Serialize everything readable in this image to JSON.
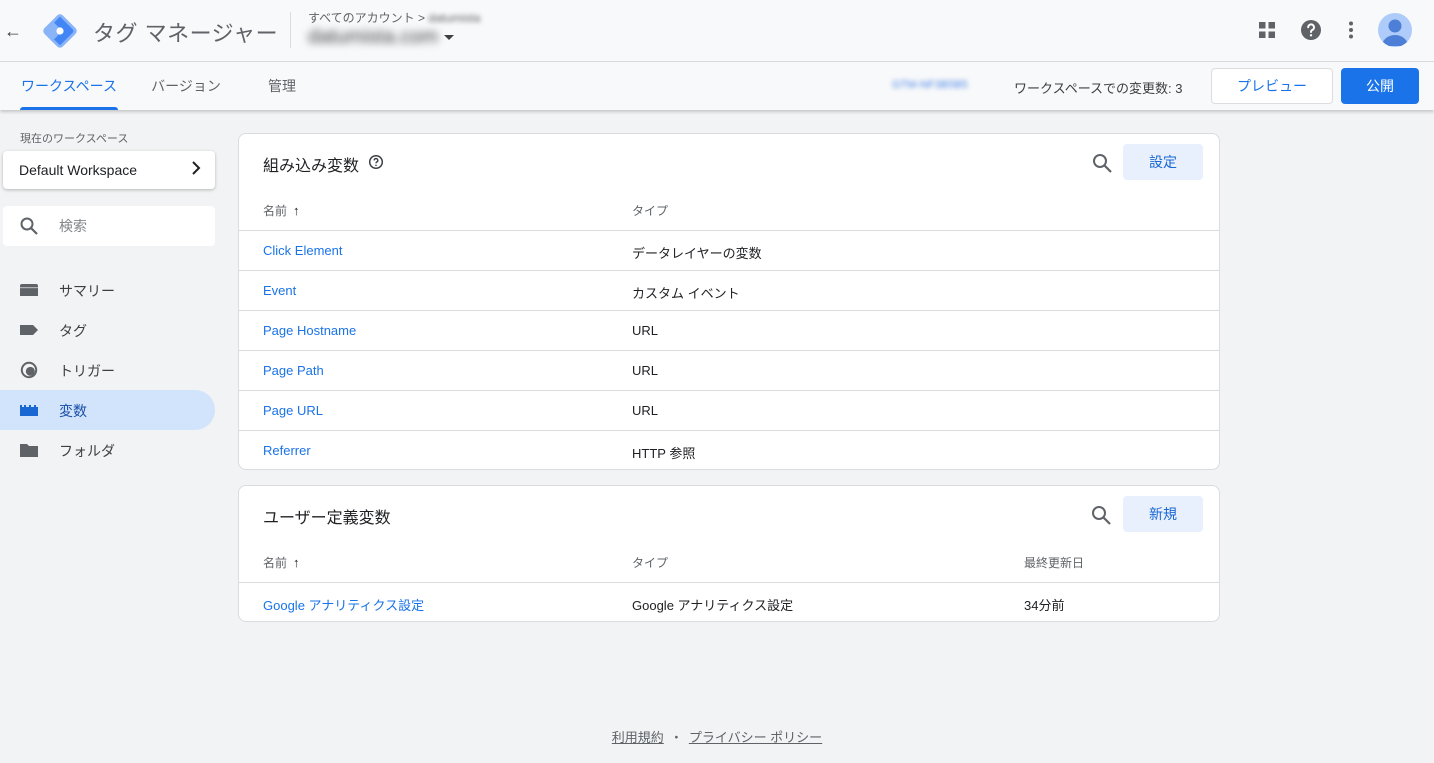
{
  "header": {
    "back_icon": "arrow-back-icon",
    "app_title": "タグ マネージャー",
    "breadcrumb_root": "すべてのアカウント",
    "breadcrumb_sep": ">",
    "breadcrumb_account": "datumista",
    "container_name": "datumista.com",
    "icons": [
      "apps-grid-icon",
      "help-icon",
      "more-vert-icon",
      "account-avatar-icon"
    ]
  },
  "subnav": {
    "tabs": [
      {
        "label": "ワークスペース",
        "active": true
      },
      {
        "label": "バージョン",
        "active": false
      },
      {
        "label": "管理",
        "active": false
      }
    ],
    "container_id": "GTM-NF3B5B5",
    "workspace_changes": "ワークスペースでの変更数: 3",
    "preview_label": "プレビュー",
    "publish_label": "公開"
  },
  "sidebar": {
    "current_workspace_label": "現在のワークスペース",
    "workspace_name": "Default Workspace",
    "search_placeholder": "検索",
    "items": [
      {
        "label": "サマリー",
        "icon": "summary-icon",
        "active": false
      },
      {
        "label": "タグ",
        "icon": "tag-icon",
        "active": false
      },
      {
        "label": "トリガー",
        "icon": "trigger-icon",
        "active": false
      },
      {
        "label": "変数",
        "icon": "variables-icon",
        "active": true
      },
      {
        "label": "フォルダ",
        "icon": "folder-icon",
        "active": false
      }
    ]
  },
  "builtin": {
    "title": "組み込み変数",
    "button": "設定",
    "col_name": "名前",
    "col_type": "タイプ",
    "rows": [
      {
        "name": "Click Element",
        "type": "データレイヤーの変数"
      },
      {
        "name": "Event",
        "type": "カスタム イベント"
      },
      {
        "name": "Page Hostname",
        "type": "URL"
      },
      {
        "name": "Page Path",
        "type": "URL"
      },
      {
        "name": "Page URL",
        "type": "URL"
      },
      {
        "name": "Referrer",
        "type": "HTTP 参照"
      }
    ]
  },
  "userdefined": {
    "title": "ユーザー定義変数",
    "button": "新規",
    "col_name": "名前",
    "col_type": "タイプ",
    "col_updated": "最終更新日",
    "rows": [
      {
        "name": "Google アナリティクス設定",
        "type": "Google アナリティクス設定",
        "updated": "34分前"
      }
    ]
  },
  "footer": {
    "terms": "利用規約",
    "separator": "・",
    "privacy": "プライバシー ポリシー"
  },
  "colors": {
    "accent": "#1a73e8",
    "active_nav_bg": "#d2e3fc",
    "page_bg": "#f1f3f4"
  }
}
